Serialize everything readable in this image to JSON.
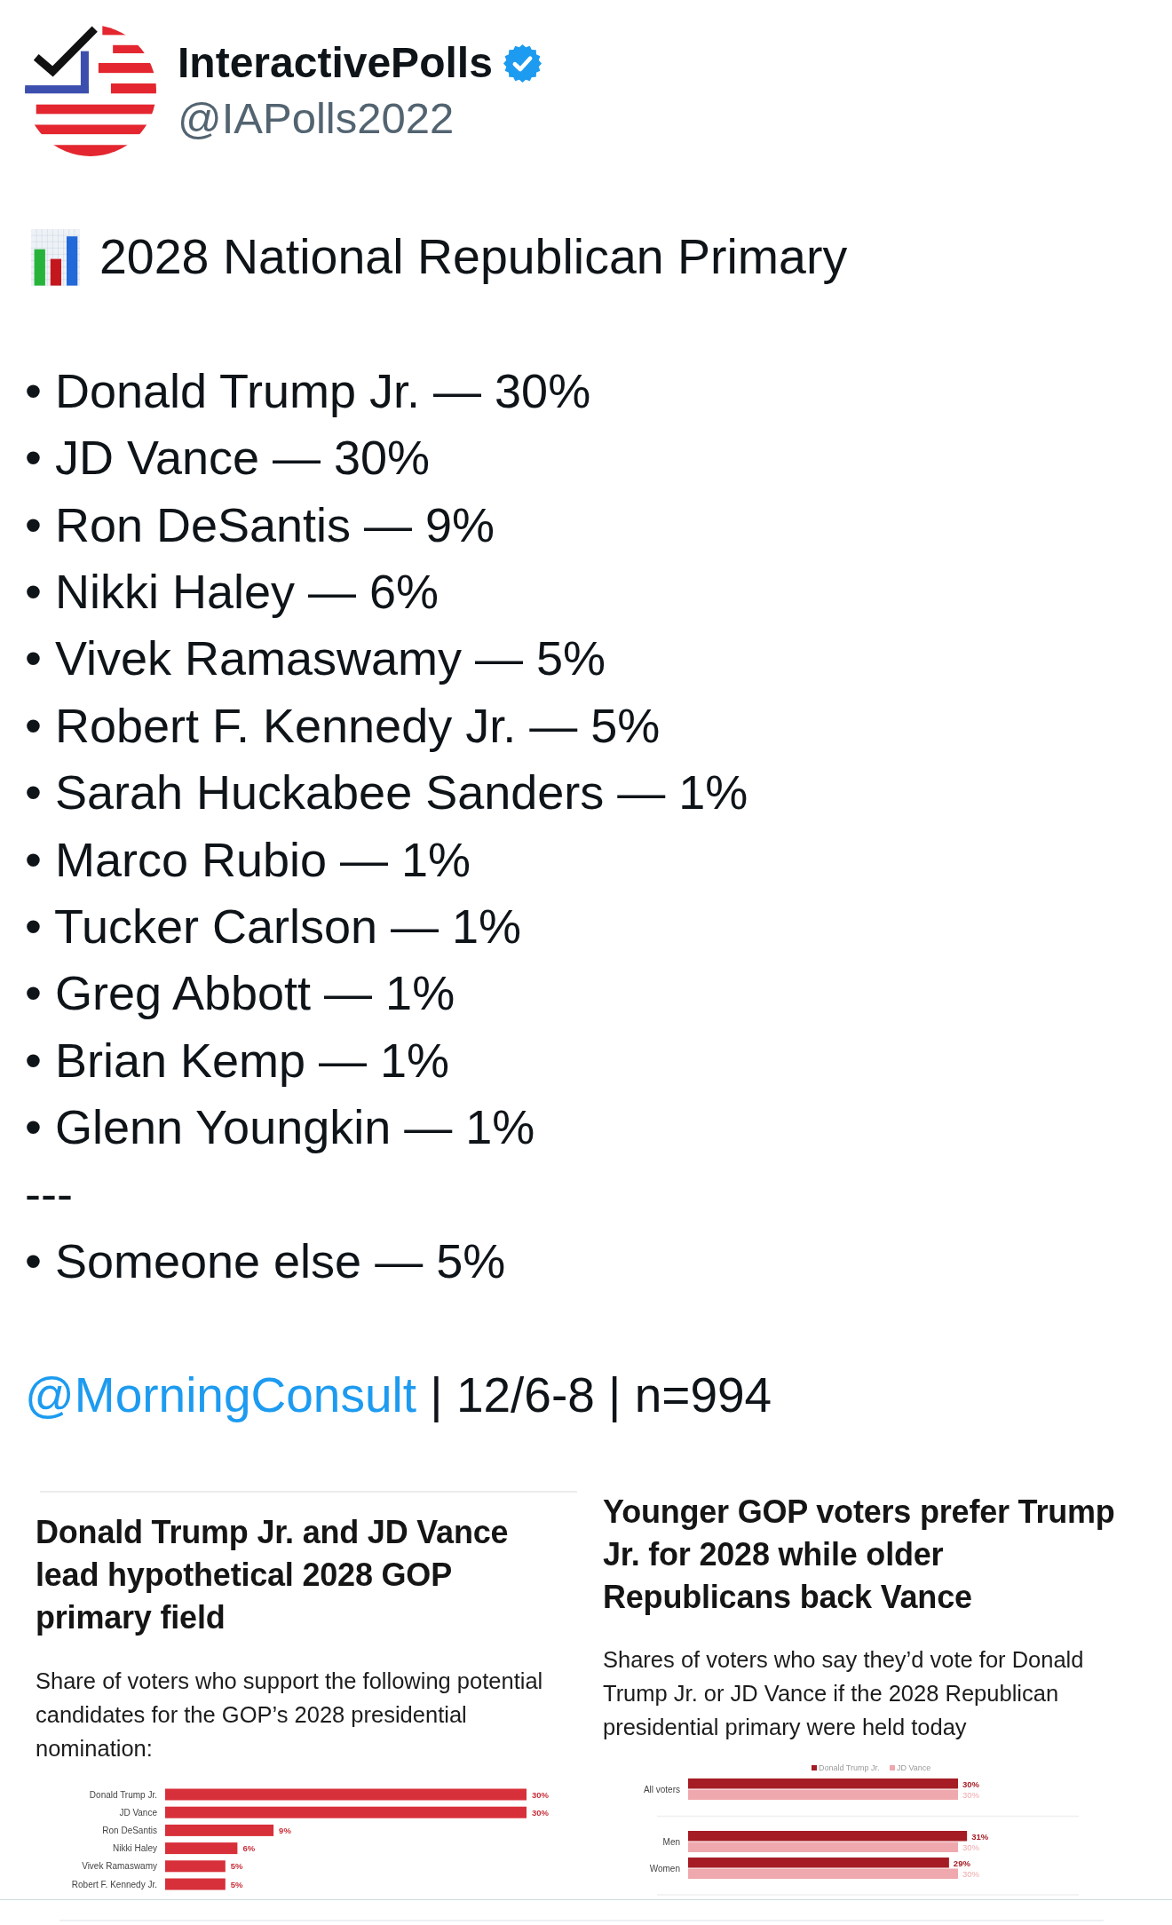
{
  "author": {
    "name": "InteractivePolls",
    "verified": true,
    "handle": "@IAPolls2022"
  },
  "post": {
    "heading": "2028 National Republican Primary",
    "lines": [
      "• Donald Trump Jr. — 30%",
      "• JD Vance — 30%",
      "• Ron DeSantis — 9%",
      "• Nikki Haley — 6%",
      "• Vivek Ramaswamy — 5%",
      "• Robert F. Kennedy Jr. — 5%",
      "• Sarah Huckabee Sanders — 1%",
      "• Marco Rubio — 1%",
      "• Tucker Carlson — 1%",
      "• Greg Abbott — 1%",
      "• Brian Kemp — 1%",
      "• Glenn Youngkin — 1%",
      "---",
      "• Someone else — 5%"
    ],
    "source": {
      "mention": "@MorningConsult",
      "text": "| 12/6-8 | n=994"
    }
  },
  "images": [
    {
      "title": "Donald Trump Jr. and JD Vance lead hypothetical 2028 GOP primary field",
      "subtitle": "Share of voters who support the following potential candidates for the GOP’s 2028 presidential nomination:",
      "chart_data": {
        "type": "bar",
        "orientation": "horizontal",
        "categories": [
          "Donald Trump Jr.",
          "JD Vance",
          "Ron DeSantis",
          "Nikki Haley",
          "Vivek Ramaswamy",
          "Robert F. Kennedy Jr."
        ],
        "values": [
          30,
          30,
          9,
          6,
          5,
          5
        ],
        "value_labels": [
          "30%",
          "30%",
          "9%",
          "6%",
          "5%",
          "5%"
        ]
      }
    },
    {
      "title": "Younger GOP voters prefer Trump Jr. for 2028 while older Republicans back Vance",
      "subtitle": "Shares of voters who say they’d vote for Donald Trump Jr. or JD Vance if the 2028 Republican presidential primary were held today",
      "chart_data": {
        "type": "bar",
        "orientation": "horizontal",
        "legend": "top",
        "categories": [
          "All voters",
          "Men",
          "Women"
        ],
        "series": [
          {
            "name": "Donald Trump Jr.",
            "color": "#a51c24",
            "values": [
              30,
              31,
              29
            ],
            "value_labels": [
              "30%",
              "31%",
              "29%"
            ]
          },
          {
            "name": "JD Vance",
            "color": "#efa9ae",
            "values": [
              30,
              30,
              30
            ],
            "value_labels": [
              "30%",
              "30%",
              "30%"
            ]
          }
        ]
      }
    }
  ]
}
